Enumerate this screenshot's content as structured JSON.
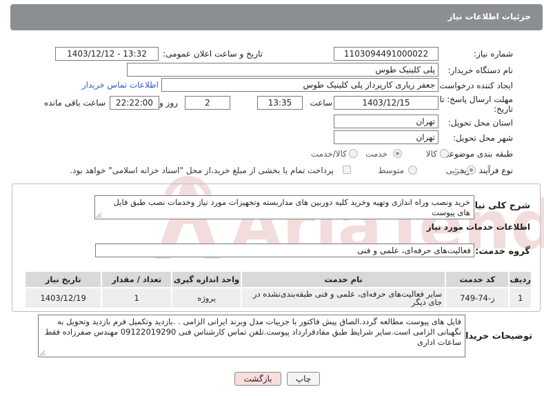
{
  "header": {
    "title": "جزئیات اطلاعات نیاز"
  },
  "fields": {
    "need_number_label": "شماره نیاز:",
    "need_number": "1103094491000022",
    "announce_datetime_label": "تاریخ و ساعت اعلان عمومی:",
    "announce_datetime": "1403/12/12 - 13:32",
    "buyer_org_label": "نام دستگاه خریدار:",
    "buyer_org": "پلی کلینیک طوس",
    "requester_label": "ایجاد کننده درخواست:",
    "requester": "جعفر زیاری کارپرداز پلی کلینیک طوس",
    "buyer_contact_link": "اطلاعات تماس خریدار",
    "deadline_label_line1": "مهلت ارسال پاسخ: تا",
    "deadline_label_line2": "تاریخ:",
    "deadline_date": "1403/12/15",
    "time_label": "ساعت",
    "deadline_time": "13:35",
    "days_label": "روز و",
    "days_value": "2",
    "remaining_time": "22:22:00",
    "remaining_label": "ساعت باقی مانده",
    "province_label": "استان محل تحویل:",
    "province": "تهران",
    "city_label": "شهر محل تحویل:",
    "city": "تهران",
    "category_label": "طبقه بندی موضوعی:",
    "category_options": [
      "کالا",
      "خدمت",
      "کالا/خدمت"
    ],
    "category_selected": "خدمت",
    "process_label": "نوع فرآیند خرید :",
    "process_options": [
      "جزیی",
      "متوسط"
    ],
    "process_selected": "جزیی",
    "payment_note": "پرداخت تمام یا بخشی از مبلغ خرید،از محل \"اسناد خزانه اسلامی\" خواهد بود."
  },
  "summary": {
    "label": "شرح کلی نیاز:",
    "text": "خرید ونصب وراه اندازی وتهیه وخرید کلیه دوربین های مداربسته وتجهیزات مورد نیاز وخدمات نصب طبق فایل های پیوست"
  },
  "services": {
    "section_title": "اطلاعات خدمات مورد نیاز",
    "group_label": "گروه خدمت:",
    "group_value": "فعالیت‌های حرفه‌ای، علمی و فنی",
    "columns": [
      "ردیف",
      "کد خدمت",
      "نام خدمت",
      "واحد اندازه گیری",
      "تعداد / مقدار",
      "تاریخ نیاز"
    ],
    "rows": [
      [
        "1",
        "ز-74-749",
        "سایر فعالیت‌های حرفه‌ای، علمی و فنی طبقه‌بندی‌نشده در جای دیگر",
        "پروژه",
        "1",
        "1403/12/19"
      ]
    ]
  },
  "buyer_notes": {
    "label": "توضیحات خریدار:",
    "text": "فایل های پیوست مطالعه گردد.الصاق پیش فاکتور با جزییات مدل وبرند ایرانی الزامی . .بازدید وتکمیل فرم بازدید وتحویل به نگهبانی الزامی است.سایر شرایط طبق مفادقرارداد پیوست.تلفن تماس کارشناس فنی 09122019290 مهندس صفرزاده فقط ساعات اداری"
  },
  "buttons": {
    "print": "چاپ",
    "back": "بازگشت"
  },
  "colors": {
    "header_bg": "#8b8f93",
    "link": "#2b5ec7",
    "back_button": "#f9dede",
    "print_button": "#f4f4f4"
  }
}
